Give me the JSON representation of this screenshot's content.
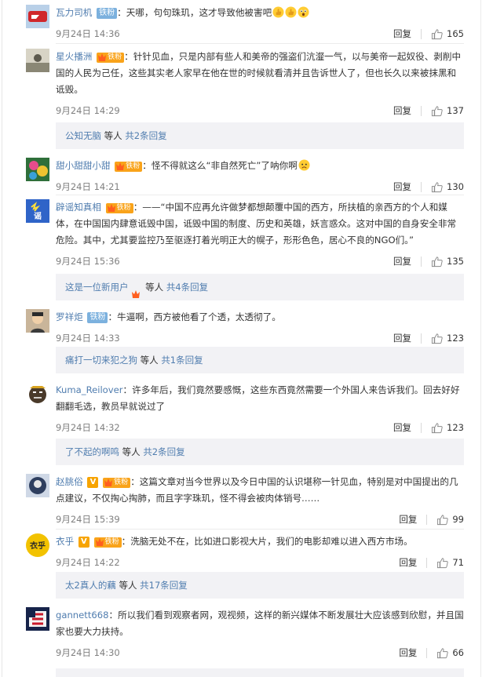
{
  "comments": [
    {
      "username": "瓦力司机",
      "name_color": "blue",
      "badges": [
        "iron"
      ],
      "iron_label": "铁粉",
      "text": "天哪，句句珠玑，这才导致他被害吧",
      "emojis": [
        "thumbs-up-icon",
        "thumbs-up-icon",
        "surprised-face-icon"
      ],
      "time": "9月24日 14:36",
      "reply_label": "回复",
      "likes": "165",
      "top": 0
    },
    {
      "username": "星火播洲",
      "name_color": "blue",
      "badges": [
        "gold"
      ],
      "gold_label": "铁粉",
      "text": "针针见血，只是内部有些人和美帝的强盗们沆瀣一气，以与美帝一起奴役、剥削中国的人民为己任，这些其实老人家早在他在世的时候就看清并且告诉世人了，但也长久以来被抹黑和诋毁。",
      "time": "9月24日 14:29",
      "reply_label": "回复",
      "likes": "137"
    },
    {
      "username": "甜小甜甜小甜",
      "name_color": "blue",
      "badges": [
        "gold"
      ],
      "gold_label": "铁粉",
      "text": "怪不得就这么“非自然死亡”了呐你啊",
      "emojis": [
        "sad-face-icon"
      ],
      "time": "9月24日 14:21",
      "reply_label": "回复",
      "likes": "130"
    },
    {
      "username": "辟谣知真相",
      "name_color": "blue",
      "badges": [
        "gold"
      ],
      "gold_label": "铁粉",
      "text": "——“中国不应再允许做梦都想颠覆中国的西方，所扶植的亲西方的个人和媒体，在中国国内肆意诋毁中国，诋毁中国的制度、历史和英雄，妖言惑众。这对中国的自身安全非常危险。其中，尤其要监控乃至驱逐打着光明正大的幌子，形形色色，居心不良的NGO们。”",
      "time": "9月24日 15:36",
      "reply_label": "回复",
      "likes": "135"
    },
    {
      "username": "罗祥炬",
      "name_color": "blue",
      "badges": [
        "iron"
      ],
      "iron_label": "铁粉",
      "text": "牛逼啊，西方被他看了个透，太透彻了。",
      "time": "9月24日 14:33",
      "reply_label": "回复",
      "likes": "123"
    },
    {
      "username": "Kuma_Reilover",
      "name_color": "blue",
      "badges": [],
      "text": "许多年后，我们竟然要感慨，这些东西竟然需要一个外国人来告诉我们。回去好好翻翻毛选，教员早就说过了",
      "time": "9月24日 14:32",
      "reply_label": "回复",
      "likes": "123"
    },
    {
      "username": "赵朓俗",
      "name_color": "blue",
      "badges": [
        "v",
        "gold"
      ],
      "v_label": "V",
      "gold_label": "铁粉",
      "text": "这篇文章对当今世界以及今日中国的认识堪称一针见血，特别是对中国提出的几点建议，不仅掏心掏肺，而且字字珠玑，怪不得会被肉体销号……",
      "time": "9月24日 15:39",
      "reply_label": "回复",
      "likes": "99"
    },
    {
      "username": "衣乎",
      "name_color": "blue",
      "badges": [
        "v",
        "gold"
      ],
      "v_label": "V",
      "gold_label": "铁粉",
      "text": "洗脑无处不在，比如进口影视大片，我们的电影却难以进入西方市场。",
      "time": "9月24日 14:22",
      "reply_label": "回复",
      "likes": "71"
    },
    {
      "username": "gannett668",
      "name_color": "blue",
      "badges": [],
      "text": "所以我们看到观察者网，观视频，这样的新兴媒体不断发展壮大应该感到欣慰，并且国家也要大力扶持。",
      "time": "9月24日 14:30",
      "reply_label": "回复",
      "likes": "66"
    }
  ],
  "sub_threads": [
    {
      "user": "公知无脑",
      "middle": " 等人 ",
      "count_label": "共2条回复"
    },
    {
      "user": "这是一位新用户",
      "middle": " 等人 ",
      "count_label": "共4条回复"
    },
    {
      "user": "痛打一切来犯之狗",
      "middle": " 等人 ",
      "count_label": "共1条回复"
    },
    {
      "user": "了不起的啊鸣",
      "middle": " 等人 ",
      "count_label": "共2条回复"
    },
    {
      "user": "太2真人的藕",
      "middle": " 等人 ",
      "count_label": "共17条回复"
    }
  ],
  "colors": {
    "name_blue": "#507daf",
    "gold_badge": "#f9a31a",
    "iron_badge": "#7cb1de",
    "sub_bg": "#f2f2f5"
  }
}
